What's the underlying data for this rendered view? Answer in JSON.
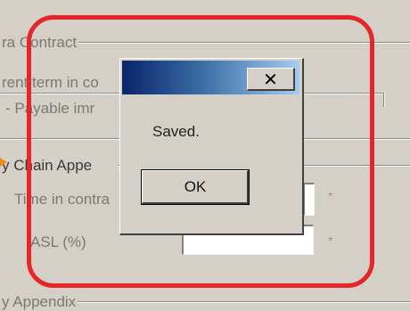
{
  "background_form": {
    "section_contract": {
      "label": "ra Contract"
    },
    "row_rent_term": {
      "label": "rent term in co"
    },
    "row_payable": {
      "label": "- Payable imr"
    },
    "section_chain": {
      "label": "y Chain Appe"
    },
    "row_time_in_contract": {
      "label": "Time in contra"
    },
    "row_asl": {
      "label": "ASL (%)"
    },
    "section_appendix": {
      "label": "y Appendix"
    },
    "required_marker": "*"
  },
  "dialog": {
    "message": "Saved.",
    "ok_label": "OK",
    "close_glyph": "✕"
  },
  "annotation": {
    "highlight_color": "#e5252a",
    "arrow_color": "#f28c18"
  }
}
